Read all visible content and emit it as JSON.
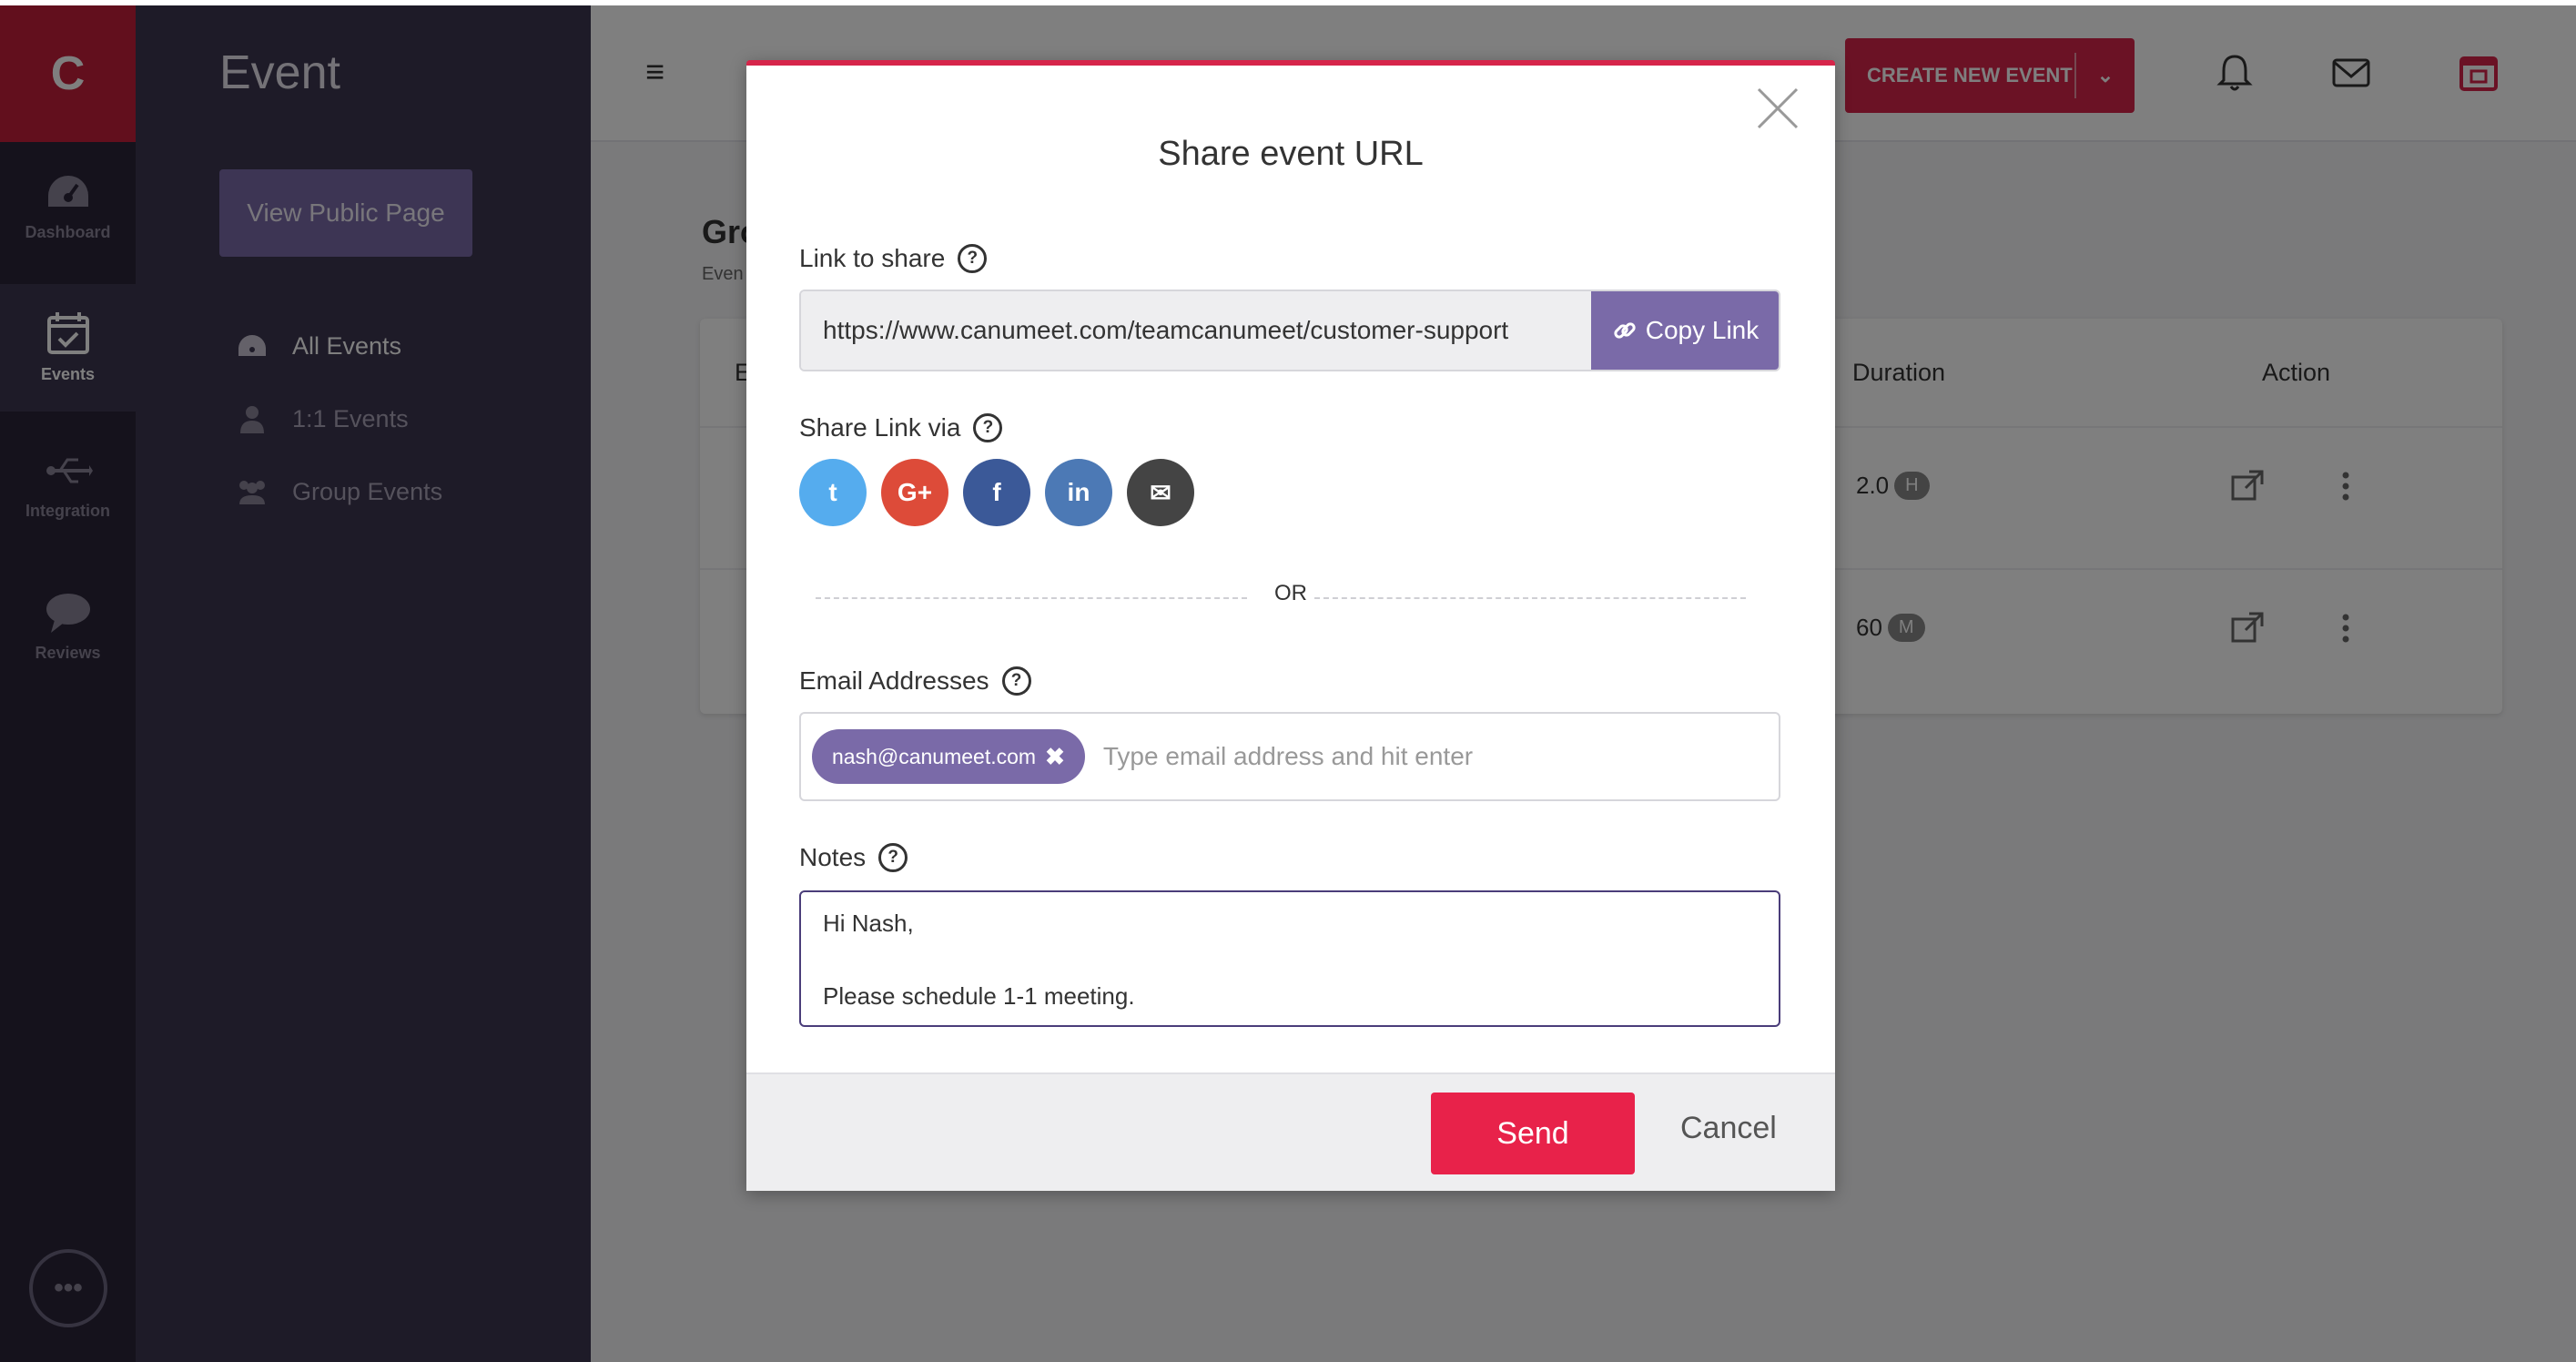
{
  "brand": {
    "logo_letter": "C",
    "accent": "#c41e3a",
    "primary_purple": "#7a6aa8"
  },
  "rail": {
    "items": [
      {
        "label": "Dashboard",
        "icon": "gauge-icon"
      },
      {
        "label": "Events",
        "icon": "calendar-check-icon"
      },
      {
        "label": "Integration",
        "icon": "usb-icon"
      },
      {
        "label": "Reviews",
        "icon": "speech-bubble-icon"
      }
    ],
    "more_icon": "ellipsis-icon"
  },
  "sidebar": {
    "title": "Event",
    "view_public_label": "View Public Page",
    "nav": [
      {
        "label": "All Events",
        "icon": "gauge-icon"
      },
      {
        "label": "1:1 Events",
        "icon": "user-icon"
      },
      {
        "label": "Group Events",
        "icon": "users-icon"
      }
    ]
  },
  "topbar": {
    "create_label": "CREATE NEW EVENT",
    "icons": [
      "bell-icon",
      "envelope-icon",
      "calendar-icon"
    ]
  },
  "page": {
    "heading": "Gro",
    "subheading": "Even",
    "table": {
      "headers": {
        "first": "E",
        "duration": "Duration",
        "action": "Action"
      },
      "rows": [
        {
          "duration_value": "2.0",
          "duration_unit": "H"
        },
        {
          "duration_value": "60",
          "duration_unit": "M"
        }
      ]
    }
  },
  "modal": {
    "title": "Share event URL",
    "link_label": "Link to share",
    "link_value": "https://www.canumeet.com/teamcanumeet/customer-support",
    "copy_label": "Copy Link",
    "share_via_label": "Share Link via",
    "share_icons": [
      {
        "icon": "twitter-icon",
        "glyph": "t",
        "color": "#55acee"
      },
      {
        "icon": "google-plus-icon",
        "glyph": "G+",
        "color": "#dd4b39"
      },
      {
        "icon": "facebook-icon",
        "glyph": "f",
        "color": "#3b5998"
      },
      {
        "icon": "linkedin-icon",
        "glyph": "in",
        "color": "#4c79b5"
      },
      {
        "icon": "email-icon",
        "glyph": "✉",
        "color": "#444444"
      }
    ],
    "or_text": "OR",
    "email_label": "Email Addresses",
    "email_chip": "nash@canumeet.com",
    "email_placeholder": "Type email address and hit enter",
    "notes_label": "Notes",
    "notes_line1": "Hi Nash,",
    "notes_line2": "Please schedule 1-1 meeting.",
    "send_label": "Send",
    "cancel_label": "Cancel",
    "help_glyph": "?"
  }
}
